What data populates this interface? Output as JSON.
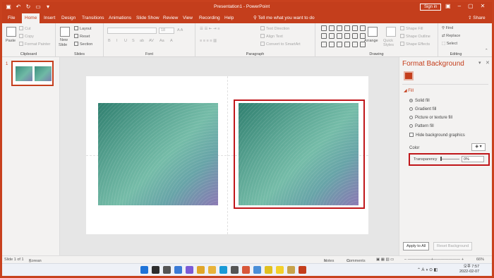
{
  "titlebar": {
    "title": "Presentation1 - PowerPoint",
    "signin": "Sign in"
  },
  "tabs": [
    "File",
    "Home",
    "Insert",
    "Design",
    "Transitions",
    "Animations",
    "Slide Show",
    "Review",
    "View",
    "Recording",
    "Help"
  ],
  "active_tab": "Home",
  "tellme": "Tell me what you want to do",
  "share": "Share",
  "ribbon": {
    "clipboard": {
      "label": "Clipboard",
      "paste": "Paste",
      "cut": "Cut",
      "copy": "Copy",
      "format_painter": "Format Painter"
    },
    "slides": {
      "label": "Slides",
      "new_slide": "New",
      "new_slide2": "Slide",
      "layout": "Layout",
      "reset": "Reset",
      "section": "Section"
    },
    "font": {
      "label": "Font",
      "size": "18",
      "styles": [
        "B",
        "I",
        "U",
        "S",
        "ab",
        "AV",
        "Aa",
        "A"
      ]
    },
    "paragraph": {
      "label": "Paragraph",
      "text_direction": "Text Direction",
      "align_text": "Align Text",
      "smartart": "Convert to SmartArt"
    },
    "drawing": {
      "label": "Drawing",
      "arrange": "Arrange",
      "quick_styles": "Quick Styles",
      "shape_fill": "Shape Fill",
      "shape_outline": "Shape Outline",
      "shape_effects": "Shape Effects"
    },
    "editing": {
      "label": "Editing",
      "find": "Find",
      "replace": "Replace",
      "select": "Select"
    }
  },
  "thumbs": {
    "slide_number": "1"
  },
  "pane": {
    "title": "Format Background",
    "fill_header": "Fill",
    "options": [
      "Solid fill",
      "Gradient fill",
      "Picture or texture fill",
      "Pattern fill"
    ],
    "selected_option": "Solid fill",
    "hide_graphics": "Hide background graphics",
    "color_label": "Color",
    "transparency_label": "Transparency",
    "transparency_value": "0%",
    "apply_all": "Apply to All",
    "reset_background": "Reset Background"
  },
  "status": {
    "slide_info": "Slide 1 of 1",
    "language": "Korean",
    "notes": "Notes",
    "comments": "Comments",
    "zoom": "66%"
  },
  "taskbar": {
    "time": "오후 7:57",
    "date": "2022-02-07"
  },
  "colors": {
    "accent": "#c43e1c",
    "highlight_box": "#c0161a"
  }
}
